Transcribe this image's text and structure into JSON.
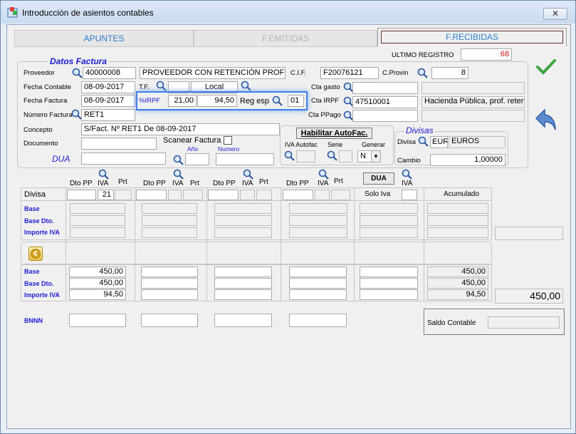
{
  "window": {
    "title": "Introducción de asientos contables"
  },
  "tabs": [
    {
      "label": "APUNTES"
    },
    {
      "label": "F.EMITIDAS"
    },
    {
      "label": "F.RECIBIDAS"
    }
  ],
  "ultimo_registro": {
    "label": "ULTIMO REGISTRO",
    "value": "68"
  },
  "datos_factura": {
    "legend": "Datos Factura",
    "proveedor_label": "Proveedor",
    "proveedor_code": "40000008",
    "proveedor_name": "PROVEEDOR CON RETENCIÓN PROFESIO",
    "cif_label": "C.I.F.",
    "cif_value": "F20076121",
    "cprovin_label": "C.Provin",
    "cprovin_value": "8",
    "fecha_contable_label": "Fecha Contable",
    "fecha_contable": "08-09-2017",
    "tf_label": "T.F.",
    "local_label": "Local",
    "fecha_factura_label": "Fecha Factura",
    "fecha_factura": "08-09-2017",
    "irpf_label": "%IRPF",
    "irpf_pct": "21,00",
    "irpf_amount": "94,50",
    "reg_esp_label": "Reg esp",
    "reg_esp_value": "01",
    "numero_factura_label": "Número Factura",
    "numero_factura": "RET1",
    "concepto_label": "Concepto",
    "concepto": "S/Fact. Nº RET1 De 08-09-2017",
    "documento_label": "Documento",
    "scanear_label": "Scanear Factura",
    "dua_label": "DUA",
    "anio_label": "Año",
    "numero_label": "Numero",
    "cta_gasto_label": "Cta gasto",
    "cta_irpf_label": "Cta  IRPF",
    "cta_irpf_value": "47510001",
    "cta_irpf_desc": "Hacienda Pública, prof. retenc",
    "cta_ppago_label": "Cta PPago",
    "habilitar_label": "Habilitar AutoFac.",
    "iva_autofac_label": "IVA Autofac",
    "serie_label": "Serie",
    "generar_label": "Generar",
    "generar_value": "N",
    "divisas_legend": "Divisas",
    "divisa_label": "Divisa",
    "divisa_code": "EUR",
    "divisa_name": "EUROS",
    "cambio_label": "Cambio",
    "cambio_value": "1,00000"
  },
  "iva_table": {
    "dto_pp": "Dto PP",
    "iva": "IVA",
    "prt": "Prt",
    "dua_button": "DUA",
    "divisa_label": "Divisa",
    "first_iva": "21",
    "solo_iva": "Solo Iva",
    "acumulado": "Acumulado",
    "base": "Base",
    "base_dto": "Base Dto.",
    "importe_iva": "Importe IVA",
    "vals": {
      "base": "450,00",
      "base_dto": "450,00",
      "importe_iva": "94,50"
    },
    "acum": {
      "base": "450,00",
      "base_dto": "450,00",
      "importe_iva": "94,50"
    },
    "total": "450,00",
    "bnnn": "BNNN",
    "saldo_contable": "Saldo Contable"
  },
  "colors": {
    "accent_blue": "#1c1cd0",
    "tab_blue": "#2d7fc9",
    "red_value": "#d01010",
    "highlight": "#3f7ee8"
  }
}
